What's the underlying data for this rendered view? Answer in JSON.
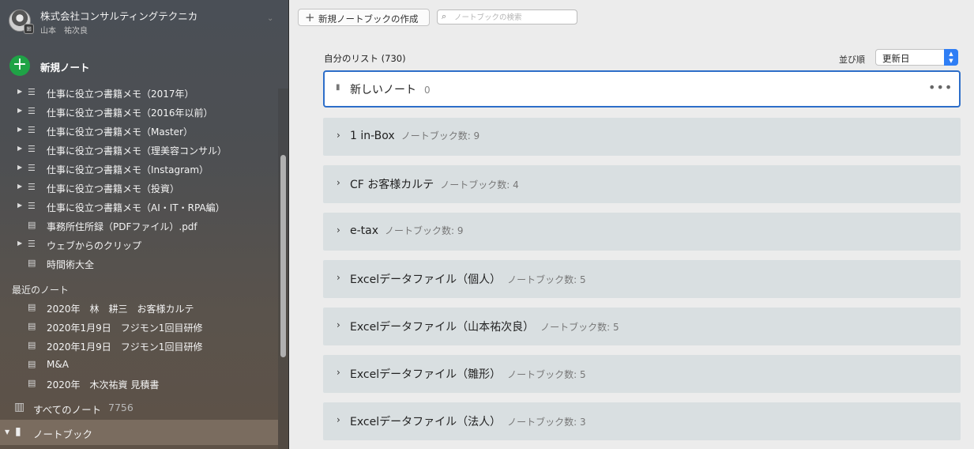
{
  "account": {
    "org": "株式会社コンサルティングテクニカ",
    "user": "山本　祐次良",
    "avatar_badge": "⊞"
  },
  "sidebar": {
    "new_note_label": "新規ノート",
    "notebooks_tree": [
      {
        "label": "仕事に役立つ書籍メモ（2017年）",
        "type": "stack",
        "expandable": true
      },
      {
        "label": "仕事に役立つ書籍メモ（2016年以前）",
        "type": "stack",
        "expandable": true
      },
      {
        "label": "仕事に役立つ書籍メモ（Master）",
        "type": "stack",
        "expandable": true
      },
      {
        "label": "仕事に役立つ書籍メモ（理美容コンサル）",
        "type": "stack",
        "expandable": true
      },
      {
        "label": "仕事に役立つ書籍メモ（Instagram）",
        "type": "stack",
        "expandable": true
      },
      {
        "label": "仕事に役立つ書籍メモ（投資）",
        "type": "stack",
        "expandable": true
      },
      {
        "label": "仕事に役立つ書籍メモ（AI・IT・RPA編）",
        "type": "stack",
        "expandable": true
      },
      {
        "label": "事務所住所録（PDFファイル）.pdf",
        "type": "note",
        "expandable": false
      },
      {
        "label": "ウェブからのクリップ",
        "type": "stack",
        "expandable": true
      },
      {
        "label": "時間術大全",
        "type": "note",
        "expandable": false
      }
    ],
    "recent_heading": "最近のノート",
    "recent_notes": [
      "2020年　林　耕三　お客様カルテ",
      "2020年1月9日　フジモン1回目研修",
      "2020年1月9日　フジモン1回目研修",
      "M&A",
      "2020年　木次祐資 見積書"
    ],
    "all_notes_label": "すべてのノート",
    "all_notes_count": "7756",
    "notebooks_label": "ノートブック"
  },
  "toolbar": {
    "new_notebook_label": "新規ノートブックの作成",
    "search_placeholder": "ノートブックの検索"
  },
  "list": {
    "heading": "自分のリスト (730)",
    "sort_label": "並び順",
    "sort_value": "更新日",
    "new_note_row": {
      "title": "新しいノート",
      "count": "0"
    },
    "stacks": [
      {
        "title": "1 in-Box",
        "meta": "ノートブック数: 9"
      },
      {
        "title": "CF お客様カルテ",
        "meta": "ノートブック数: 4"
      },
      {
        "title": "e-tax",
        "meta": "ノートブック数: 9"
      },
      {
        "title": "Excelデータファイル（個人）",
        "meta": "ノートブック数: 5"
      },
      {
        "title": "Excelデータファイル（山本祐次良）",
        "meta": "ノートブック数: 5"
      },
      {
        "title": "Excelデータファイル（雛形）",
        "meta": "ノートブック数: 5"
      },
      {
        "title": "Excelデータファイル（法人）",
        "meta": "ノートブック数: 3"
      }
    ]
  }
}
